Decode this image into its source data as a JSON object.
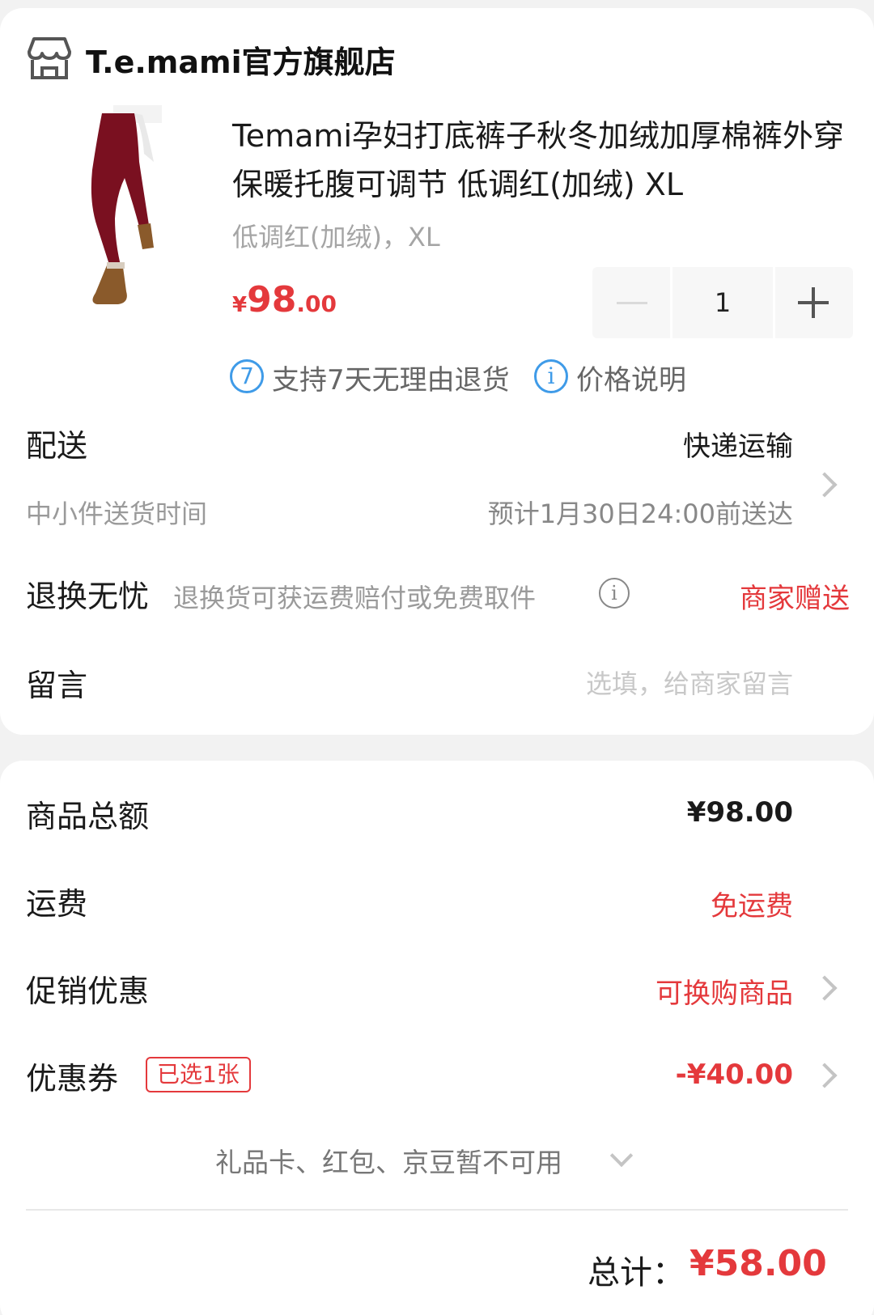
{
  "store": {
    "name": "T.e.mami官方旗舰店",
    "icon": "store-icon"
  },
  "product": {
    "title": "Temami孕妇打底裤子秋冬加绒加厚棉裤外穿保暖托腹可调节 低调红(加绒) XL",
    "spec": "低调红(加绒)，XL",
    "price_symbol": "¥",
    "price_int": "98",
    "price_dec": ".00",
    "quantity": "1"
  },
  "services": [
    {
      "badge": "7",
      "text": "支持7天无理由退货"
    },
    {
      "badge": "i",
      "text": "价格说明"
    }
  ],
  "delivery": {
    "label": "配送",
    "method": "快递运输",
    "sub_label": "中小件送货时间",
    "estimate": "预计1月30日24:00前送达"
  },
  "returns": {
    "label": "退换无忧",
    "desc": "退换货可获运费赔付或免费取件",
    "value": "商家赠送"
  },
  "message": {
    "label": "留言",
    "placeholder": "选填，给商家留言"
  },
  "summary": {
    "goods_total_label": "商品总额",
    "goods_total_value": "¥98.00",
    "shipping_label": "运费",
    "shipping_value": "免运费",
    "promo_label": "促销优惠",
    "promo_value": "可换购商品",
    "coupon_label": "优惠券",
    "coupon_tag": "已选1张",
    "coupon_value": "-¥40.00",
    "unavailable": "礼品卡、红包、京豆暂不可用",
    "total_label": "总计：",
    "total_value": "¥58.00"
  },
  "colors": {
    "accent_red": "#e4393c",
    "link_blue": "#3f9be8",
    "product_red": "#7a1020"
  }
}
